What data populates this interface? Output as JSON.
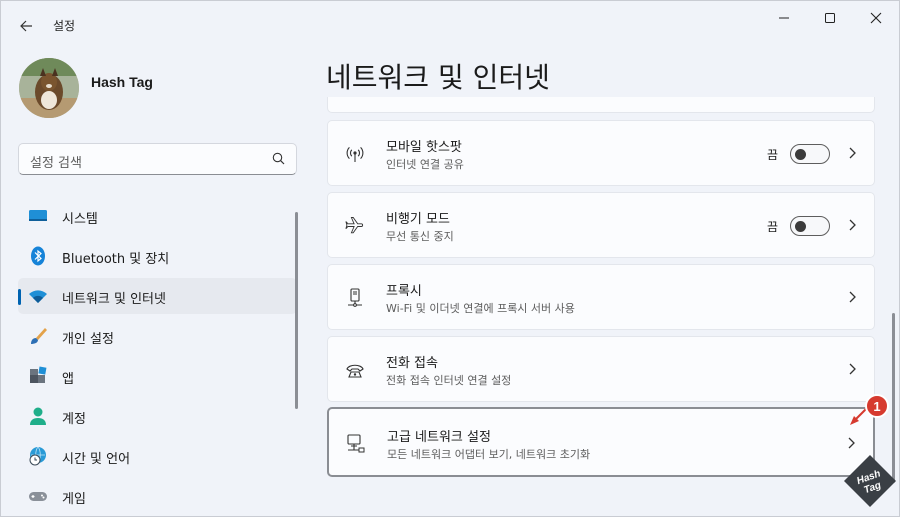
{
  "window": {
    "title": "설정",
    "back_icon": "back-arrow-icon",
    "min_icon": "minimize-icon",
    "max_icon": "maximize-icon",
    "close_icon": "close-icon"
  },
  "profile": {
    "name": "Hash Tag"
  },
  "search": {
    "placeholder": "설정 검색"
  },
  "sidebar": {
    "items": [
      {
        "label": "시스템",
        "icon": "system-icon"
      },
      {
        "label": "Bluetooth 및 장치",
        "icon": "bluetooth-icon"
      },
      {
        "label": "네트워크 및 인터넷",
        "icon": "wifi-icon",
        "active": true
      },
      {
        "label": "개인 설정",
        "icon": "brush-icon"
      },
      {
        "label": "앱",
        "icon": "apps-icon"
      },
      {
        "label": "계정",
        "icon": "account-icon"
      },
      {
        "label": "시간 및 언어",
        "icon": "globe-clock-icon"
      },
      {
        "label": "게임",
        "icon": "gamepad-icon"
      }
    ]
  },
  "main": {
    "title": "네트워크 및 인터넷",
    "cards": [
      {
        "title": "모바일 핫스팟",
        "subtitle": "인터넷 연결 공유",
        "toggle_label": "끔",
        "toggle_on": false,
        "icon": "hotspot-icon"
      },
      {
        "title": "비행기 모드",
        "subtitle": "무선 통신 중지",
        "toggle_label": "끔",
        "toggle_on": false,
        "icon": "airplane-icon"
      },
      {
        "title": "프록시",
        "subtitle": "Wi-Fi 및 이더넷 연결에 프록시 서버 사용",
        "icon": "proxy-icon"
      },
      {
        "title": "전화 접속",
        "subtitle": "전화 접속 인터넷 연결 설정",
        "icon": "dialup-icon"
      },
      {
        "title": "고급 네트워크 설정",
        "subtitle": "모든 네트워크 어댑터 보기, 네트워크 초기화",
        "icon": "network-pc-icon"
      }
    ]
  },
  "annotation": {
    "badge": "1"
  },
  "logo": {
    "text_1": "Hash",
    "text_2": "Tag"
  },
  "colors": {
    "accent": "#0063b1",
    "badge": "#d63a2f",
    "background": "#f0f3f9",
    "card": "#fbfcfe"
  }
}
